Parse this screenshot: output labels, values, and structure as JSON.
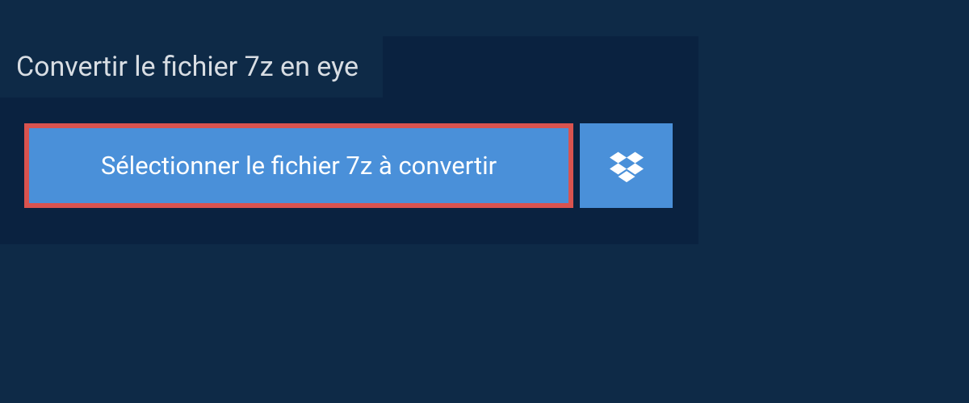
{
  "header": {
    "title": "Convertir le fichier 7z en eye"
  },
  "buttons": {
    "select_file_label": "Sélectionner le fichier 7z à convertir"
  },
  "colors": {
    "background": "#0e2a47",
    "panel": "#0a2240",
    "button_primary": "#4a90d9",
    "button_highlight_border": "#d9534f",
    "text_light": "#ffffff",
    "text_header": "#d8dde3"
  }
}
